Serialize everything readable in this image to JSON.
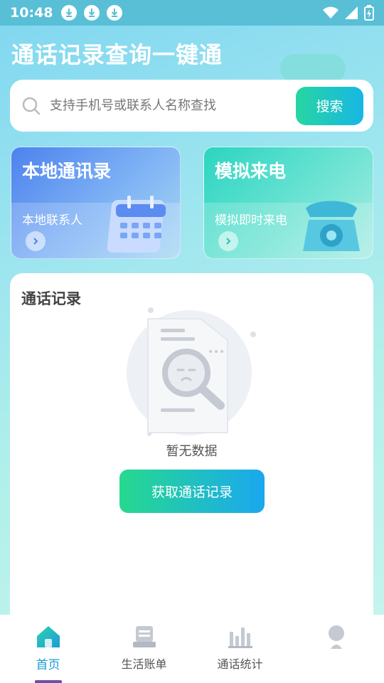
{
  "status_bar": {
    "time": "10:48"
  },
  "header": {
    "title": "通话记录查询一键通"
  },
  "search": {
    "placeholder": "支持手机号或联系人名称查找",
    "button_label": "搜索"
  },
  "cards": [
    {
      "title": "本地通讯录",
      "subtitle": "本地联系人"
    },
    {
      "title": "模拟来电",
      "subtitle": "模拟即时来电"
    }
  ],
  "records": {
    "title": "通话记录",
    "empty_text": "暂无数据",
    "fetch_button": "获取通话记录"
  },
  "bottom_nav": {
    "items": [
      {
        "label": "首页",
        "icon": "home-icon",
        "active": true
      },
      {
        "label": "生活账单",
        "icon": "bill-icon",
        "active": false
      },
      {
        "label": "通话统计",
        "icon": "stats-icon",
        "active": false
      },
      {
        "label": "",
        "icon": "profile-icon",
        "active": false
      }
    ]
  },
  "colors": {
    "accent_green": "#27d6a1",
    "accent_blue": "#17b6e4",
    "nav_active": "#1a9bd6"
  }
}
